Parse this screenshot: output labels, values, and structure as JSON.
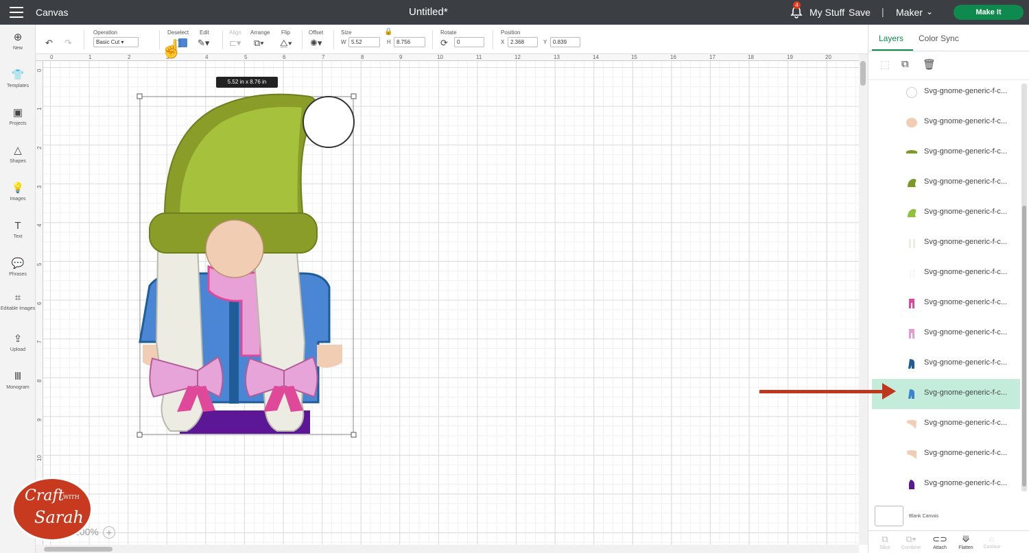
{
  "topbar": {
    "app_title": "Canvas",
    "doc_title": "Untitled*",
    "notification_count": "4",
    "my_stuff": "My Stuff",
    "save": "Save",
    "separator": "|",
    "machine": "Maker",
    "make_it": "Make It"
  },
  "toolbar": {
    "operation_label": "Operation",
    "operation_value": "Basic Cut",
    "deselect_label": "Deselect",
    "edit_label": "Edit",
    "align_label": "Align",
    "arrange_label": "Arrange",
    "flip_label": "Flip",
    "offset_label": "Offset",
    "size_label": "Size",
    "w_label": "W",
    "w_value": "5.52",
    "h_label": "H",
    "h_value": "8.756",
    "rotate_label": "Rotate",
    "rotate_value": "0",
    "position_label": "Position",
    "x_label": "X",
    "x_value": "2.368",
    "y_label": "Y",
    "y_value": "0.839",
    "swatch_color": "#4a86d3"
  },
  "leftnav": [
    {
      "label": "New",
      "icon": "plus-icon"
    },
    {
      "label": "Templates",
      "icon": "shirt-icon"
    },
    {
      "label": "Projects",
      "icon": "projects-icon"
    },
    {
      "label": "Shapes",
      "icon": "shapes-icon"
    },
    {
      "label": "Images",
      "icon": "bulb-icon"
    },
    {
      "label": "Text",
      "icon": "text-icon"
    },
    {
      "label": "Phrases",
      "icon": "chat-icon"
    },
    {
      "label": "Editable Images",
      "icon": "editable-images-icon"
    },
    {
      "label": "Upload",
      "icon": "upload-icon"
    },
    {
      "label": "Monogram",
      "icon": "monogram-icon"
    }
  ],
  "canvas": {
    "dimension_tooltip": "5.52  in x 8.76  in",
    "ruler_top": [
      "0",
      "1",
      "2",
      "3",
      "4",
      "5",
      "6",
      "7",
      "8",
      "9",
      "10",
      "11",
      "12",
      "13",
      "14",
      "15",
      "16",
      "17",
      "18",
      "19",
      "20"
    ],
    "ruler_left": [
      "0",
      "1",
      "2",
      "3",
      "4",
      "5",
      "6",
      "7",
      "8",
      "9",
      "10"
    ],
    "zoom": "100%"
  },
  "panel": {
    "tab_layers": "Layers",
    "tab_color_sync": "Color Sync",
    "layers": [
      {
        "name": "Svg-gnome-generic-f-c...",
        "color": "#ffffff"
      },
      {
        "name": "Svg-gnome-generic-f-c...",
        "color": "#f1cdb3"
      },
      {
        "name": "Svg-gnome-generic-f-c...",
        "color": "#7a9a28"
      },
      {
        "name": "Svg-gnome-generic-f-c...",
        "color": "#7a9a28"
      },
      {
        "name": "Svg-gnome-generic-f-c...",
        "color": "#8fc23a"
      },
      {
        "name": "Svg-gnome-generic-f-c...",
        "color": "#ecece3"
      },
      {
        "name": "Svg-gnome-generic-f-c...",
        "color": "#f7f7f2"
      },
      {
        "name": "Svg-gnome-generic-f-c...",
        "color": "#e0489a"
      },
      {
        "name": "Svg-gnome-generic-f-c...",
        "color": "#e39bd0"
      },
      {
        "name": "Svg-gnome-generic-f-c...",
        "color": "#1f5c98"
      },
      {
        "name": "Svg-gnome-generic-f-c...",
        "color": "#3c84cf",
        "selected": true
      },
      {
        "name": "Svg-gnome-generic-f-c...",
        "color": "#f1cdb3"
      },
      {
        "name": "Svg-gnome-generic-f-c...",
        "color": "#f1cdb3"
      },
      {
        "name": "Svg-gnome-generic-f-c...",
        "color": "#5b1796"
      }
    ],
    "blank_canvas": "Blank Canvas",
    "bottom_tools": [
      {
        "label": "Slice",
        "enabled": false
      },
      {
        "label": "Combine",
        "enabled": false
      },
      {
        "label": "Attach",
        "enabled": true
      },
      {
        "label": "Flatten",
        "enabled": true
      },
      {
        "label": "Contour",
        "enabled": false
      }
    ]
  },
  "logo": {
    "line1": "Craft",
    "line2": "WITH",
    "line3": "Sarah"
  },
  "colors": {
    "topbar": "#3b3f44",
    "accent": "#0f8a4e",
    "selected_row": "#c4ecdb",
    "arrow": "#c0361c",
    "hat": "#8a9d29",
    "coat": "#4a86d3",
    "scarf": "#e8a1d6",
    "bow": "#e7a4d9",
    "boots": "#5b1796"
  }
}
